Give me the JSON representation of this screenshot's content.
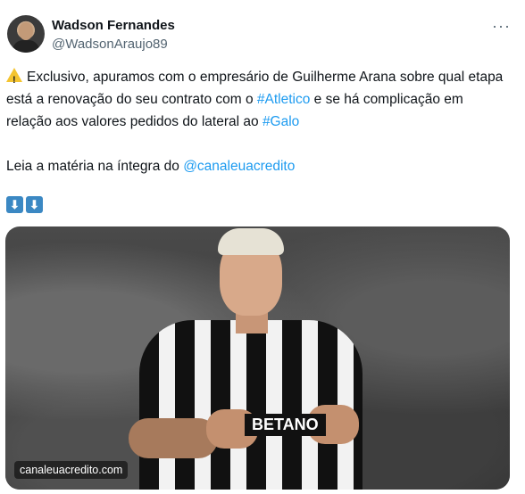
{
  "author": {
    "name": "Wadson Fernandes",
    "handle": "@WadsonAraujo89"
  },
  "more_label": "···",
  "tweet": {
    "warning_icon": "warning-icon",
    "segments": [
      "Exclusivo, apuramos com o empresário de Guilherme Arana sobre qual etapa está a renovação do seu contrato com o ",
      "#Atletico",
      " e se há complicação em relação aos valores pedidos do lateral ao ",
      "#Galo"
    ],
    "line2_prefix": "Leia a matéria na íntegra do ",
    "line2_mention": "@canaleuacredito",
    "arrows": [
      "⬇",
      "⬇"
    ]
  },
  "media": {
    "watermark": "canaleuacredito.com",
    "sponsor": "BETANO"
  },
  "colors": {
    "link": "#1d9bf0",
    "text": "#0f1419",
    "secondary": "#536471"
  }
}
